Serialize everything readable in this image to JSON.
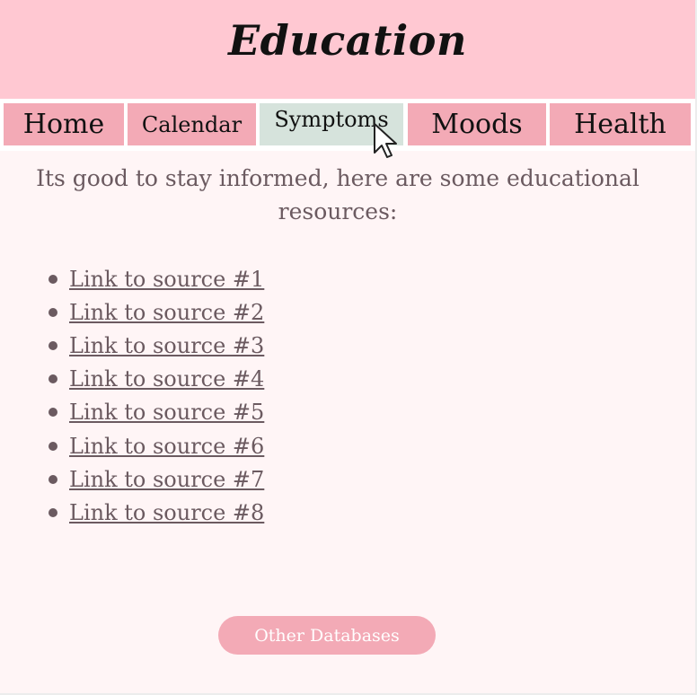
{
  "header": {
    "title": "Education"
  },
  "nav": {
    "tabs": [
      {
        "label": "Home"
      },
      {
        "label": "Calendar"
      },
      {
        "label": "Symptoms",
        "active": true
      },
      {
        "label": "Moods"
      },
      {
        "label": "Health"
      }
    ]
  },
  "main": {
    "intro": "Its good to stay informed, here are some educational resources:",
    "links": [
      "Link to source #1",
      "Link to source #2",
      "Link to source #3",
      "Link to source #4",
      "Link to source #5",
      "Link to source #6",
      "Link to source #7",
      "Link to source #8"
    ],
    "button_label": "Other Databases"
  },
  "colors": {
    "header_bg": "#ffc8d2",
    "tab_bg": "#f3aab6",
    "active_tab_bg": "#d6e3dc",
    "page_bg": "#fff5f6",
    "text": "#6b5a60"
  },
  "icons": {
    "pointer": "mouse-pointer-icon"
  }
}
